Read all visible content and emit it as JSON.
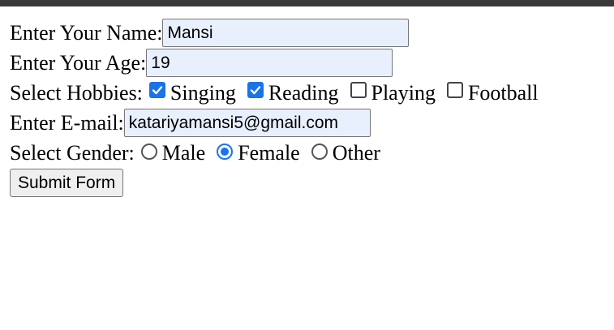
{
  "form": {
    "name_label": "Enter Your Name:",
    "name_value": "Mansi",
    "age_label": "Enter Your Age:",
    "age_value": "19",
    "hobbies_label": "Select Hobbies:",
    "hobbies": [
      {
        "label": "Singing",
        "checked": true
      },
      {
        "label": "Reading",
        "checked": true
      },
      {
        "label": "Playing",
        "checked": false
      },
      {
        "label": "Football",
        "checked": false
      }
    ],
    "email_label": "Enter E-mail:",
    "email_value": "katariyamansi5@gmail.com",
    "gender_label": "Select Gender:",
    "genders": [
      {
        "label": "Male",
        "selected": false
      },
      {
        "label": "Female",
        "selected": true
      },
      {
        "label": "Other",
        "selected": false
      }
    ],
    "submit_label": "Submit Form"
  },
  "colors": {
    "accent": "#1a73e8",
    "autofill_bg": "#e8f0fe"
  }
}
